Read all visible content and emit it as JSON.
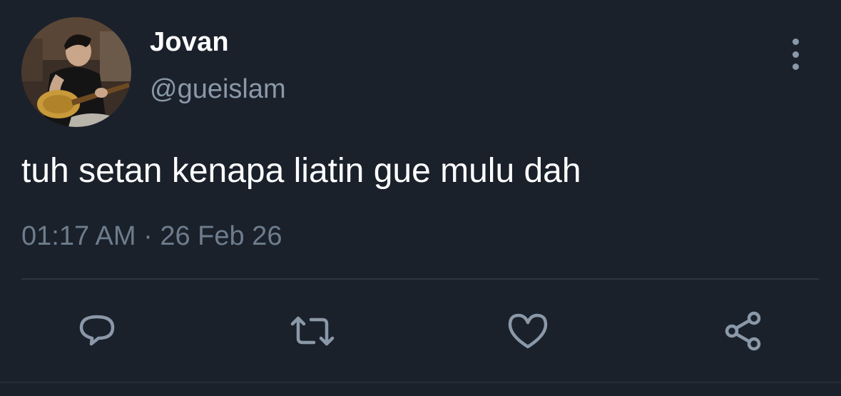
{
  "author": {
    "name": "Jovan",
    "handle": "@gueislam"
  },
  "tweet": {
    "text": "tuh setan kenapa liatin gue mulu dah",
    "meta": "01:17 AM · 26 Feb 26"
  },
  "actions": {
    "reply": "reply-icon",
    "retweet": "retweet-icon",
    "like": "heart-icon",
    "share": "share-icon"
  },
  "colors": {
    "background": "#1a212b",
    "primary_text": "#ffffff",
    "secondary_text": "#8a98a8",
    "divider": "#2c3540"
  }
}
